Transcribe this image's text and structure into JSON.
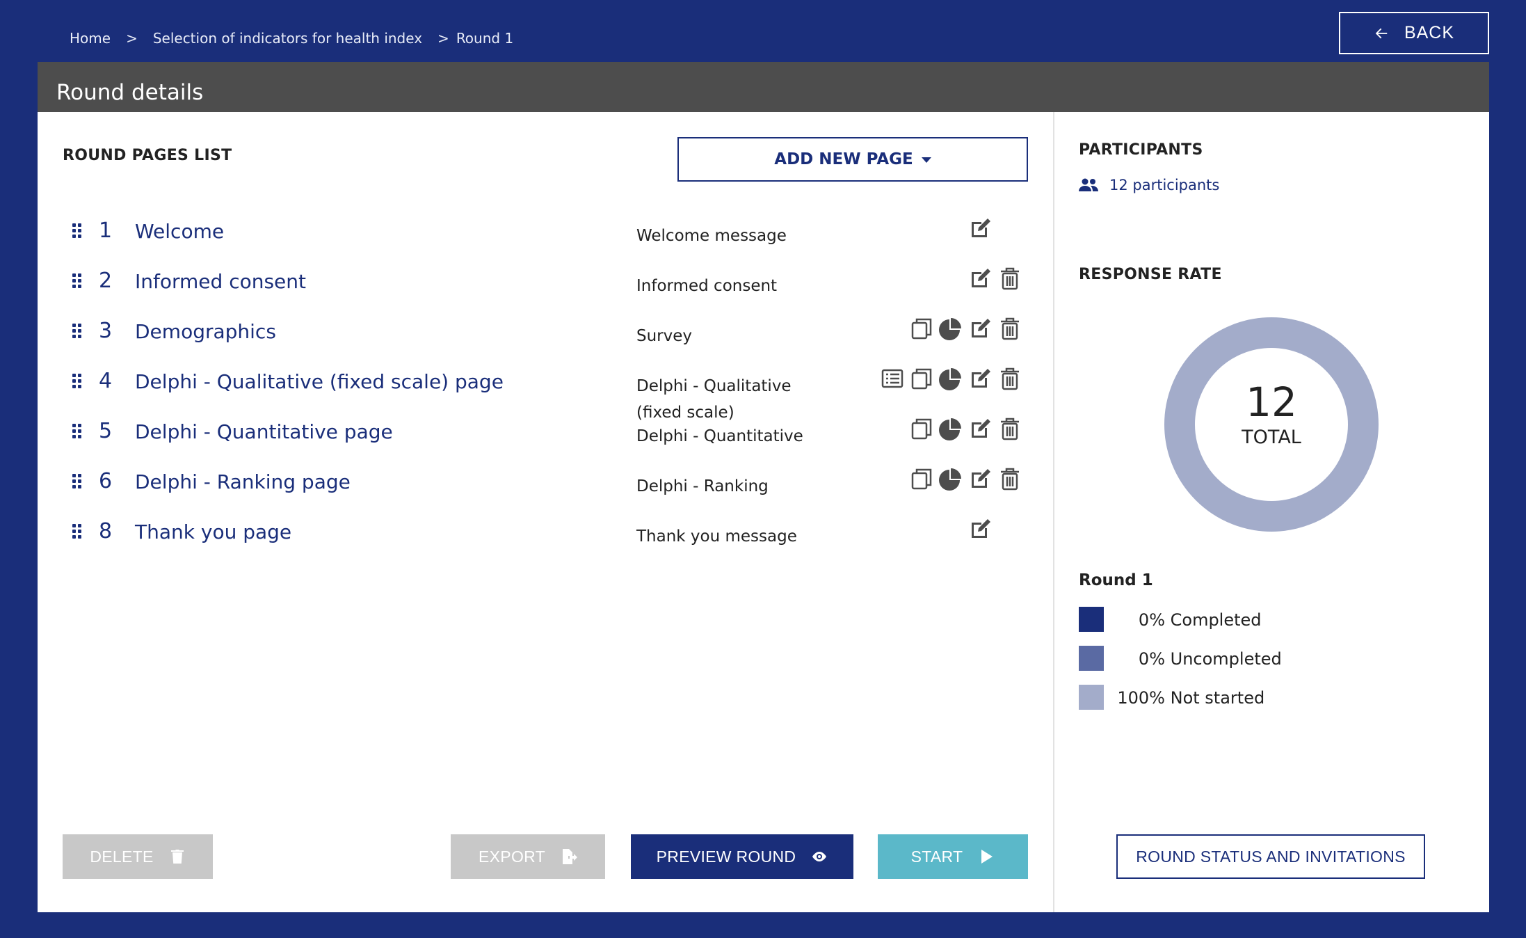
{
  "breadcrumb": {
    "home": "Home",
    "sep": ">",
    "project": "Selection of indicators for health index",
    "current": "Round 1"
  },
  "back_label": "BACK",
  "panel_title": "Round details",
  "pages_list": {
    "title": "ROUND PAGES LIST",
    "add_label": "ADD NEW PAGE",
    "rows": [
      {
        "num": "1",
        "title": "Welcome",
        "type": "Welcome message",
        "actions": [
          "edit"
        ]
      },
      {
        "num": "2",
        "title": "Informed consent",
        "type": "Informed consent",
        "actions": [
          "edit",
          "delete"
        ]
      },
      {
        "num": "3",
        "title": "Demographics",
        "type": "Survey",
        "actions": [
          "copy",
          "results",
          "edit",
          "delete"
        ]
      },
      {
        "num": "4",
        "title": "Delphi - Qualitative (fixed scale) page",
        "type": "Delphi - Qualitative (fixed scale)",
        "actions": [
          "list",
          "copy",
          "results",
          "edit",
          "delete"
        ]
      },
      {
        "num": "5",
        "title": "Delphi - Quantitative page",
        "type": "Delphi - Quantitative",
        "actions": [
          "copy",
          "results",
          "edit",
          "delete"
        ]
      },
      {
        "num": "6",
        "title": "Delphi - Ranking page",
        "type": "Delphi - Ranking",
        "actions": [
          "copy",
          "results",
          "edit",
          "delete"
        ]
      },
      {
        "num": "8",
        "title": "Thank you page",
        "type": "Thank you message",
        "actions": [
          "edit"
        ]
      }
    ]
  },
  "buttons": {
    "delete": "DELETE",
    "export": "EXPORT",
    "preview": "PREVIEW ROUND",
    "start": "START",
    "status": "ROUND STATUS AND INVITATIONS"
  },
  "participants": {
    "title": "PARTICIPANTS",
    "link": "12 participants"
  },
  "response": {
    "title": "RESPONSE RATE",
    "total": "12",
    "total_label": "TOTAL",
    "round": "Round 1",
    "legend": [
      {
        "pct": "0%",
        "label": "Completed",
        "color": "#1a2e7a",
        "value": 0
      },
      {
        "pct": "0%",
        "label": "Uncompleted",
        "color": "#5a6aa3",
        "value": 0
      },
      {
        "pct": "100%",
        "label": "Not started",
        "color": "#a3acca",
        "value": 100
      }
    ]
  }
}
